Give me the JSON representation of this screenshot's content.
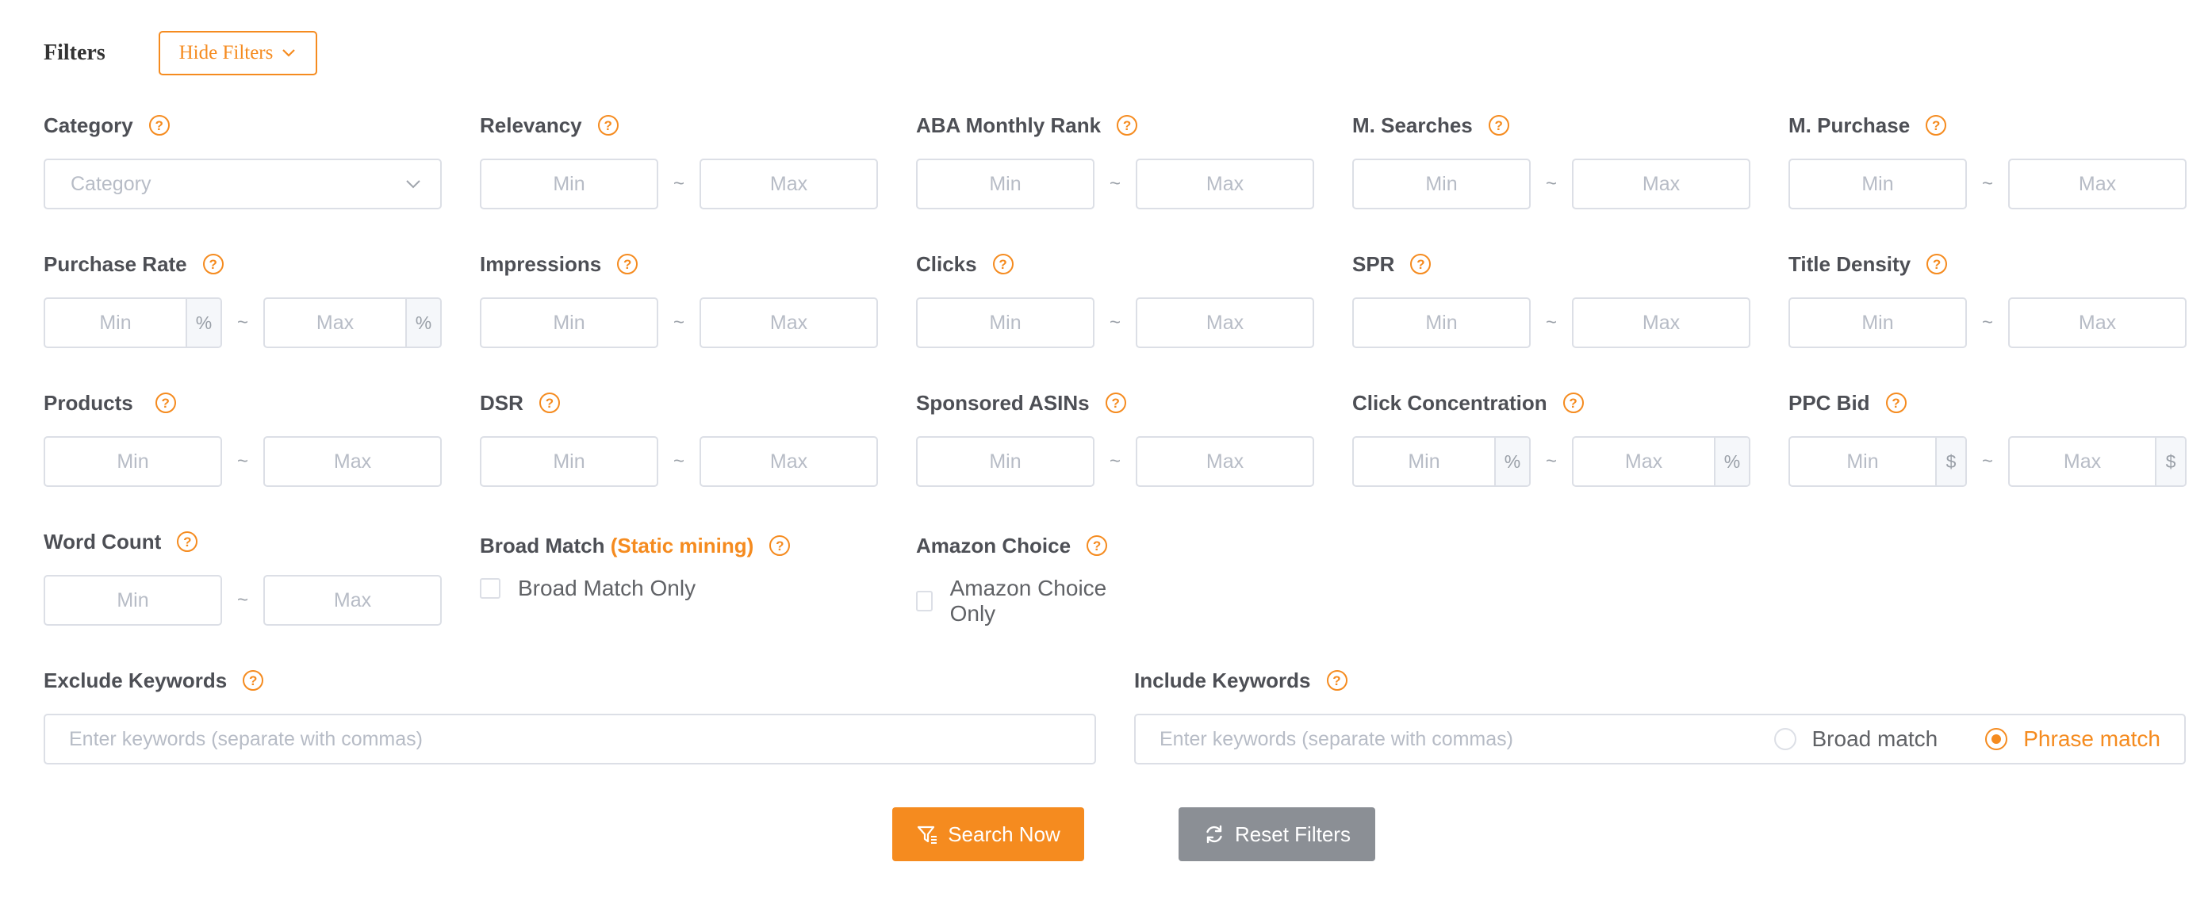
{
  "header": {
    "title": "Filters",
    "hide_filters_label": "Hide Filters",
    "hide_filters_icon": "chevron-down-icon"
  },
  "placeholders": {
    "min": "Min",
    "max": "Max",
    "keywords": "Enter keywords (separate with commas)"
  },
  "filters": {
    "category": {
      "label": "Category",
      "placeholder": "Category"
    },
    "relevancy": {
      "label": "Relevancy"
    },
    "aba_monthly_rank": {
      "label": "ABA Monthly Rank"
    },
    "m_searches": {
      "label": "M. Searches"
    },
    "m_purchase": {
      "label": "M. Purchase"
    },
    "purchase_rate": {
      "label": "Purchase Rate",
      "unit": "%"
    },
    "impressions": {
      "label": "Impressions"
    },
    "clicks": {
      "label": "Clicks"
    },
    "spr": {
      "label": "SPR"
    },
    "title_density": {
      "label": "Title Density"
    },
    "products": {
      "label": "Products"
    },
    "dsr": {
      "label": "DSR"
    },
    "sponsored_asins": {
      "label": "Sponsored ASINs"
    },
    "click_concentration": {
      "label": "Click Concentration",
      "unit": "%"
    },
    "ppc_bid": {
      "label": "PPC Bid",
      "unit": "$"
    },
    "word_count": {
      "label": "Word Count"
    },
    "broad_match": {
      "label": "Broad Match",
      "accent": "(Static mining)",
      "checkbox_label": "Broad Match Only",
      "checked": false
    },
    "amazon_choice": {
      "label": "Amazon Choice",
      "checkbox_label": "Amazon Choice Only",
      "checked": false
    },
    "exclude_keywords": {
      "label": "Exclude Keywords"
    },
    "include_keywords": {
      "label": "Include Keywords",
      "options": [
        {
          "label": "Broad match",
          "selected": false
        },
        {
          "label": "Phrase match",
          "selected": true
        }
      ]
    }
  },
  "actions": {
    "search_label": "Search Now",
    "reset_label": "Reset Filters"
  },
  "colors": {
    "accent": "#f58b1f",
    "border": "#dcdfe6",
    "reset_button": "#8b8f95"
  }
}
